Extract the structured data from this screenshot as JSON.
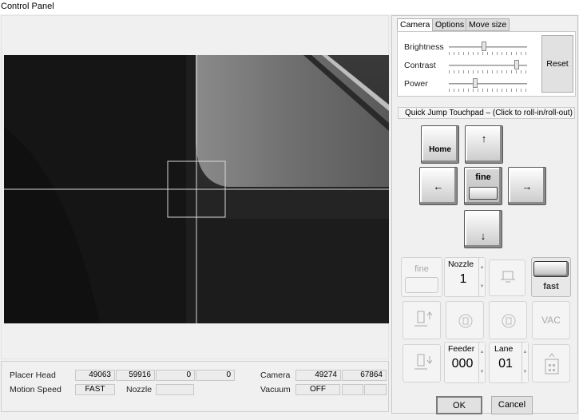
{
  "window": {
    "title": "Control Panel"
  },
  "tabs": [
    {
      "label": "Camera",
      "active": true
    },
    {
      "label": "Options",
      "active": false
    },
    {
      "label": "Move size",
      "active": false
    }
  ],
  "camera_tab": {
    "sliders": [
      {
        "label": "Brightness",
        "value": 0.4
      },
      {
        "label": "Contrast",
        "value": 0.88
      },
      {
        "label": "Power",
        "value": 0.3
      }
    ],
    "reset_label": "Reset"
  },
  "jump": {
    "bar_label": "Quick Jump Touchpad – (Click to roll-in/roll-out)",
    "home_label": "Home",
    "fine_label": "fine",
    "arrows": {
      "up": "↑",
      "down": "↓",
      "left": "←",
      "right": "→"
    }
  },
  "tools": {
    "fine_label": "fine",
    "nozzle_label": "Nozzle",
    "nozzle_value": "1",
    "fast_label": "fast",
    "vac_label": "VAC",
    "feeder_label": "Feeder",
    "feeder_value": "000",
    "lane_label": "Lane",
    "lane_value": "01"
  },
  "status": {
    "placer_head_label": "Placer Head",
    "placer_head_values": [
      "49063",
      "59916",
      "0",
      "0"
    ],
    "camera_label": "Camera",
    "camera_values": [
      "49274",
      "67864"
    ],
    "motion_speed_label": "Motion Speed",
    "motion_speed_value": "FAST",
    "nozzle_label": "Nozzle",
    "vacuum_label": "Vacuum",
    "vacuum_value": "OFF"
  },
  "dialog": {
    "ok_label": "OK",
    "cancel_label": "Cancel"
  },
  "colors": {
    "background": "#f0f0f0",
    "camera_bg": "#141414",
    "crosshair": "#d8d8d8",
    "accent_border": "#555555"
  }
}
